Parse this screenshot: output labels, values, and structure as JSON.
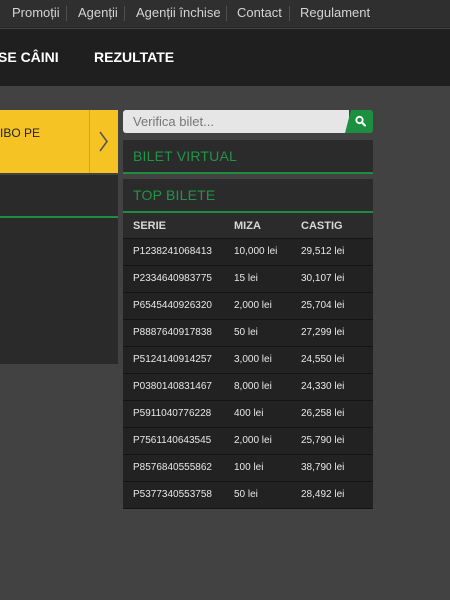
{
  "top_nav": {
    "items": [
      "Promoții",
      "Agenții",
      "Agenții închise",
      "Contact",
      "Regulament"
    ]
  },
  "main_nav": {
    "items": [
      "SE CÂINI",
      "REZULTATE"
    ]
  },
  "promo": {
    "text": "IBO PE"
  },
  "search": {
    "placeholder": "Verifica bilet..."
  },
  "panels": {
    "bilet_virtual": "BILET VIRTUAL",
    "top_bilete": "TOP BILETE"
  },
  "tickets_table": {
    "headers": [
      "SERIE",
      "MIZA",
      "CASTIG"
    ],
    "rows": [
      [
        "P1238241068413",
        "10,000 lei",
        "29,512 lei"
      ],
      [
        "P2334640983775",
        "15 lei",
        "30,107 lei"
      ],
      [
        "P6545440926320",
        "2,000 lei",
        "25,704 lei"
      ],
      [
        "P8887640917838",
        "50 lei",
        "27,299 lei"
      ],
      [
        "P5124140914257",
        "3,000 lei",
        "24,550 lei"
      ],
      [
        "P0380140831467",
        "8,000 lei",
        "24,330 lei"
      ],
      [
        "P5911040776228",
        "400 lei",
        "26,258 lei"
      ],
      [
        "P7561140643545",
        "2,000 lei",
        "25,790 lei"
      ],
      [
        "P8576840555862",
        "100 lei",
        "38,790 lei"
      ],
      [
        "P5377340553758",
        "50 lei",
        "28,492 lei"
      ]
    ]
  },
  "colors": {
    "accent_green": "#1f9647",
    "promo_yellow": "#f6c324"
  }
}
